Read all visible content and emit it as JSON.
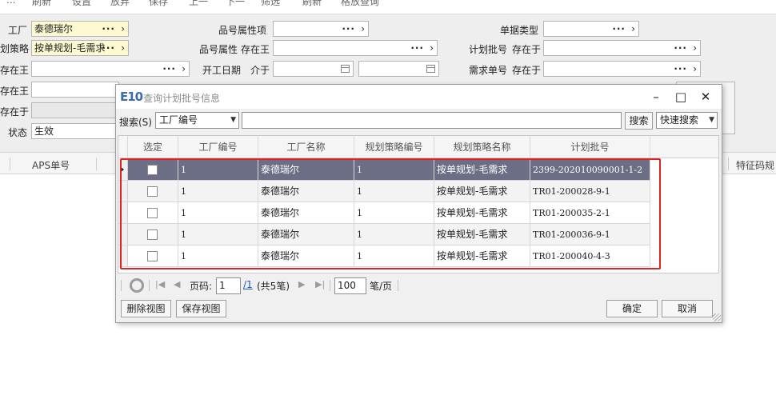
{
  "topbar": {
    "items": [
      "...",
      "刷新",
      "设置",
      "放弃",
      "保存",
      "上一",
      "下一",
      "筛选",
      "刷新",
      "格放查询"
    ]
  },
  "form": {
    "factory_label": "工厂",
    "factory_value": "泰德瑞尔",
    "strategy_label": "划策略",
    "strategy_value": "按单规划-毛需求",
    "exists_label_1": "存在王",
    "exists_label_2": "存在王",
    "exists_label_3": "存在于",
    "status_label": "状态",
    "status_value": "生效",
    "part_attr_item_label": "品号属性项",
    "part_attr_label": "品号属性",
    "part_attr_op": "存在王",
    "start_date_label": "开工日期",
    "start_date_op": "介于",
    "doc_type_label": "单据类型",
    "plan_lot_label": "计划批号",
    "plan_lot_op": "存在于",
    "demand_no_label": "需求单号",
    "demand_no_op": "存在于"
  },
  "bg_grid": {
    "aps_label": "APS单号",
    "feature_label": "特征码规"
  },
  "dialog": {
    "logo": "E10",
    "title": "查询计划批号信息",
    "min_glyph": "–",
    "max_glyph": "□",
    "close_glyph": "✕",
    "search_label": "搜索(S)",
    "search_field": "工厂编号",
    "search_query": "",
    "search_button": "搜索",
    "quick_search": "快速搜索",
    "columns": [
      "选定",
      "工厂编号",
      "工厂名称",
      "规划策略编号",
      "规划策略名称",
      "计划批号"
    ],
    "rows": [
      {
        "factory_no": "1",
        "factory_name": "泰德瑞尔",
        "strategy_no": "1",
        "strategy_name": "按单规划-毛需求",
        "plan_lot": "2399-202010090001-1-2"
      },
      {
        "factory_no": "1",
        "factory_name": "泰德瑞尔",
        "strategy_no": "1",
        "strategy_name": "按单规划-毛需求",
        "plan_lot": "TR01-200028-9-1"
      },
      {
        "factory_no": "1",
        "factory_name": "泰德瑞尔",
        "strategy_no": "1",
        "strategy_name": "按单规划-毛需求",
        "plan_lot": "TR01-200035-2-1"
      },
      {
        "factory_no": "1",
        "factory_name": "泰德瑞尔",
        "strategy_no": "1",
        "strategy_name": "按单规划-毛需求",
        "plan_lot": "TR01-200036-9-1"
      },
      {
        "factory_no": "1",
        "factory_name": "泰德瑞尔",
        "strategy_no": "1",
        "strategy_name": "按单规划-毛需求",
        "plan_lot": "TR01-200040-4-3"
      }
    ],
    "pager": {
      "page_label": "页码:",
      "page_value": "1",
      "page_total": "/1",
      "count_text": "(共5笔)",
      "page_size": "100",
      "page_size_unit": "笔/页"
    },
    "delete_view": "删除视图",
    "save_view": "保存视图",
    "ok": "确定",
    "cancel": "取消"
  },
  "colors": {
    "selected_row": "#6c6e86",
    "highlight_box": "#e02424",
    "logo": "#3b6ea8",
    "required_field": "#fdfad2"
  }
}
